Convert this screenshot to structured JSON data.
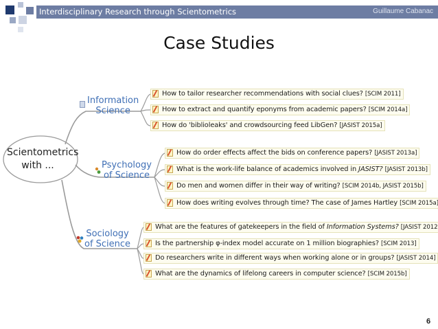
{
  "header": {
    "title": "Interdisciplinary Research through Scientometrics",
    "author": "Guillaume Cabanac"
  },
  "slide": {
    "title": "Case Studies",
    "page_number": "6"
  },
  "colors": {
    "header_bar": "#6d7da3",
    "branch_text": "#3f6fb5",
    "central_border": "#9a9a9a",
    "connector": "#9a9a9a"
  },
  "mindmap": {
    "center": {
      "line1": "Scientometrics",
      "line2": "with ..."
    },
    "branches": [
      {
        "line1": "Information",
        "line2": "Science",
        "icon": "document-icon",
        "items": [
          {
            "text": "How to tailor researcher recommendations with social clues?",
            "venue": "[SCIM 2011]"
          },
          {
            "text": "How to extract and quantify eponyms from academic papers?",
            "venue": "[SCIM 2014a]"
          },
          {
            "text": "How do 'biblioleaks' and crowdsourcing feed LibGen?",
            "venue": "[JASIST 2015a]"
          }
        ]
      },
      {
        "line1": "Psychology",
        "line2": "of Science",
        "icon": "people-icon",
        "items": [
          {
            "text": "How do order effects affect the bids on conference papers?",
            "venue": "[JASIST 2013a]"
          },
          {
            "text": "What is the work-life balance of academics involved in",
            "italic": "JASIST?",
            "venue": "[JASIST 2013b]"
          },
          {
            "text": "Do men and women differ in their way of writing?",
            "venue": "[SCIM 2014b, JASIST 2015b]"
          },
          {
            "text": "How does writing evolves through time? The case of James Hartley",
            "venue": "[SCIM 2015a]"
          }
        ]
      },
      {
        "line1": "Sociology",
        "line2": "of Science",
        "icon": "group-icon",
        "items": [
          {
            "text": "What are the features of gatekeepers in the field of",
            "italic": "Information Systems?",
            "venue": "[JASIST 2012]"
          },
          {
            "text": "Is the partnership φ-index model accurate on 1 million biographies?",
            "venue": "[SCIM 2013]"
          },
          {
            "text": "Do researchers write in different ways when working alone or in groups?",
            "venue": "[JASIST 2014]"
          },
          {
            "text": "What are the dynamics of lifelong careers in computer science?",
            "venue": "[SCIM 2015b]"
          }
        ]
      }
    ]
  }
}
